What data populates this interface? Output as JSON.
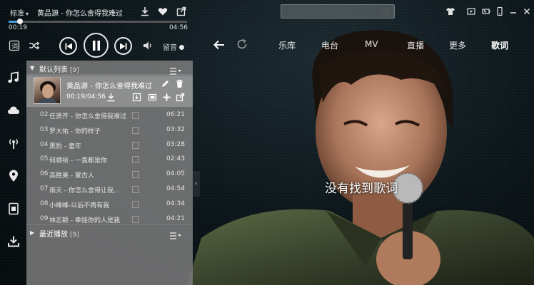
{
  "player": {
    "quality": "标准",
    "song_title": "黄品源 - 你怎么舍得我难过",
    "time_current": "00:19",
    "time_total": "04:56",
    "progress": 0.064,
    "lyric_toggle_label": "留音"
  },
  "search": {
    "placeholder": "",
    "value": ""
  },
  "nav": {
    "tabs": [
      {
        "label": "乐库",
        "active": false
      },
      {
        "label": "电台",
        "active": false
      },
      {
        "label": "MV",
        "active": false
      },
      {
        "label": "直播",
        "active": false
      },
      {
        "label": "更多",
        "active": false
      },
      {
        "label": "歌词",
        "active": true
      }
    ]
  },
  "sidebar": {
    "icons": [
      "music-note-icon",
      "cloud-icon",
      "radio-antenna-icon",
      "location-pin-icon",
      "phone-transfer-icon",
      "download-icon"
    ]
  },
  "playlist": {
    "name": "默认列表",
    "count": "[9]",
    "now_playing": {
      "title": "黄品源 - 你怎么舍得我难过",
      "time": "00:19/04:56"
    },
    "items": [
      {
        "index": "02",
        "title": "任贤齐 - 你怎么舍得我难过",
        "duration": "06:21"
      },
      {
        "index": "03",
        "title": "罗大佑 - 你的样子",
        "duration": "03:32"
      },
      {
        "index": "04",
        "title": "黑豹 - 童年",
        "duration": "03:28"
      },
      {
        "index": "05",
        "title": "何顺祯 - 一直都是你",
        "duration": "02:43"
      },
      {
        "index": "06",
        "title": "高胜美 - 蒙古人",
        "duration": "04:05"
      },
      {
        "index": "07",
        "title": "雨天 - 你怎么舍得让我...",
        "duration": "04:54"
      },
      {
        "index": "08",
        "title": "小峰峰-以后不再有我",
        "duration": "04:34"
      },
      {
        "index": "09",
        "title": "林志颖 - 牵挂你的人是我",
        "duration": "04:21"
      }
    ],
    "recent_name": "最近播放",
    "recent_count": "[9]"
  },
  "lyrics": {
    "empty_message": "没有找到歌词"
  }
}
